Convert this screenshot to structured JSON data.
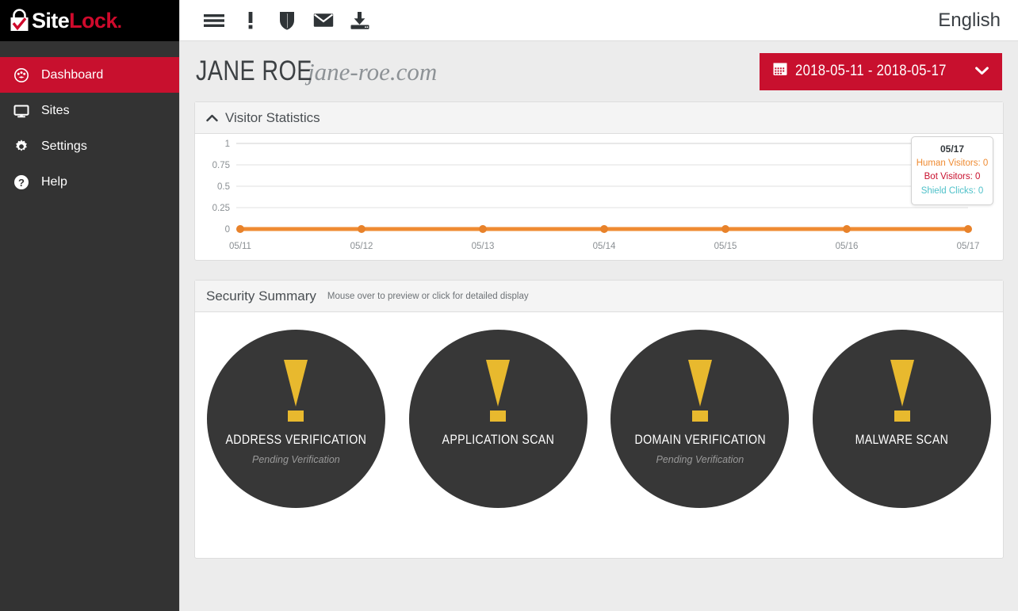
{
  "brand": {
    "logo_text_1": "Site",
    "logo_text_2": "Lock",
    "logo_dot": ".",
    "logo_icon": "padlock-check-icon",
    "accent_red": "#c8102e",
    "accent_orange": "#ef8b32",
    "accent_teal": "#4fc1c9",
    "accent_yellow": "#e8b92e",
    "dark": "#373737"
  },
  "sidebar": {
    "items": [
      {
        "label": "Dashboard",
        "icon": "gauge-icon",
        "active": true
      },
      {
        "label": "Sites",
        "icon": "monitor-icon",
        "active": false
      },
      {
        "label": "Settings",
        "icon": "gear-icon",
        "active": false
      },
      {
        "label": "Help",
        "icon": "question-circle-icon",
        "active": false
      }
    ]
  },
  "topbar": {
    "icons": [
      {
        "name": "hamburger-menu-icon",
        "label": "Menu"
      },
      {
        "name": "exclamation-icon",
        "label": "Alerts"
      },
      {
        "name": "shield-icon",
        "label": "Shield"
      },
      {
        "name": "envelope-icon",
        "label": "Messages"
      },
      {
        "name": "download-icon",
        "label": "Downloads"
      }
    ],
    "language": "English"
  },
  "page": {
    "account_name": "JANE ROE",
    "domain": "jane-roe.com",
    "date_range": "2018-05-11 - 2018-05-17",
    "calendar_icon": "calendar-icon",
    "chevron_icon": "chevron-down-icon"
  },
  "visitor_panel": {
    "title": "Visitor Statistics",
    "collapse_icon": "chevron-up-icon"
  },
  "tooltip": {
    "date": "05/17",
    "human": "Human Visitors: 0",
    "bot": "Bot Visitors: 0",
    "shield": "Shield Clicks: 0"
  },
  "security_panel": {
    "title": "Security Summary",
    "subtitle": "Mouse over to preview or click for detailed display",
    "items": [
      {
        "label": "ADDRESS VERIFICATION",
        "status": "Pending Verification",
        "icon": "warning-exclamation-icon"
      },
      {
        "label": "APPLICATION SCAN",
        "status": "",
        "icon": "warning-exclamation-icon"
      },
      {
        "label": "DOMAIN VERIFICATION",
        "status": "Pending Verification",
        "icon": "warning-exclamation-icon"
      },
      {
        "label": "MALWARE SCAN",
        "status": "",
        "icon": "warning-exclamation-icon"
      }
    ]
  },
  "chart_data": {
    "type": "line",
    "title": "Visitor Statistics",
    "xlabel": "",
    "ylabel": "",
    "x": [
      "05/11",
      "05/12",
      "05/13",
      "05/14",
      "05/15",
      "05/16",
      "05/17"
    ],
    "yticks": [
      "0",
      "0.25",
      "0.5",
      "0.75",
      "1"
    ],
    "ylim": [
      0,
      1
    ],
    "grid": true,
    "legend": "none",
    "series": [
      {
        "name": "Human Visitors",
        "color": "#ef8b32",
        "values": [
          0,
          0,
          0,
          0,
          0,
          0,
          0
        ]
      },
      {
        "name": "Bot Visitors",
        "color": "#c8102e",
        "values": [
          0,
          0,
          0,
          0,
          0,
          0,
          0
        ]
      },
      {
        "name": "Shield Clicks",
        "color": "#4fc1c9",
        "values": [
          0,
          0,
          0,
          0,
          0,
          0,
          0
        ]
      }
    ]
  }
}
